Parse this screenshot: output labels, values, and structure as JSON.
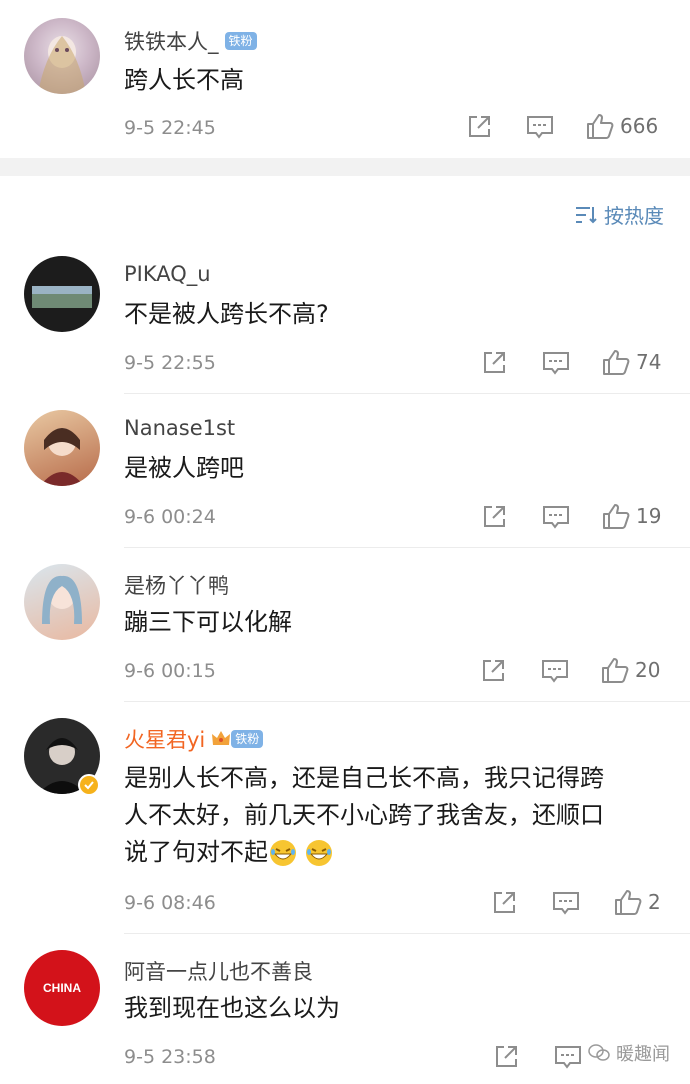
{
  "pinned": {
    "user": "铁铁本人_",
    "badge": "铁粉",
    "text": "跨人长不高",
    "time": "9-5 22:45",
    "likes": "666"
  },
  "sort_label": "按热度",
  "comments": [
    {
      "user": "PIKAQ_u",
      "text": "不是被人跨长不高?",
      "time": "9-5 22:55",
      "likes": "74"
    },
    {
      "user": "Nanase1st",
      "text": "是被人跨吧",
      "time": "9-6 00:24",
      "likes": "19"
    },
    {
      "user": "是杨丫丫鸭",
      "text": "蹦三下可以化解",
      "time": "9-6 00:15",
      "likes": "20"
    },
    {
      "user": "火星君yi",
      "badge": "铁粉",
      "text_line1": "是别人长不高，还是自己长不高，我只记得跨",
      "text_line2": "人不太好，前几天不小心跨了我舍友，还顺口",
      "text_line3": "说了句对不起",
      "time": "9-6 08:46",
      "likes": "2"
    },
    {
      "user": "阿音一点儿也不善良",
      "avatar_text": "CHINA",
      "text": "我到现在也这么以为",
      "time": "9-5 23:58"
    }
  ],
  "watermark": "暖趣闻",
  "colors": {
    "accent": "#5a8ab8",
    "vip_name": "#f26522",
    "fan_badge": "#7fb2e6"
  }
}
